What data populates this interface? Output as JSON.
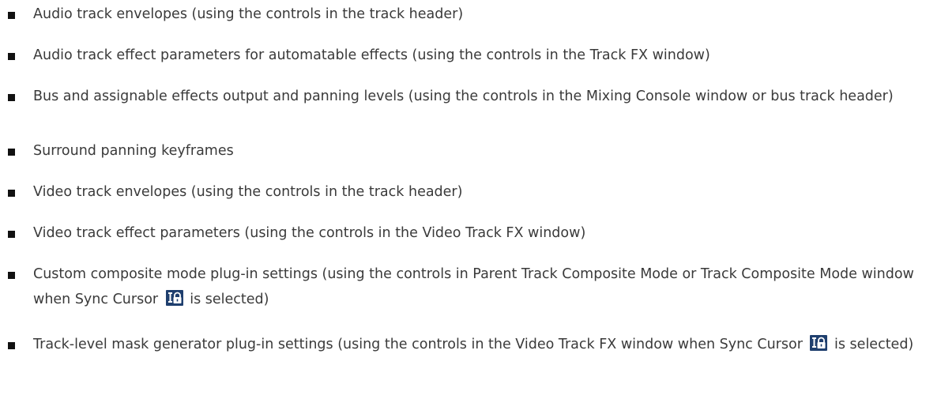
{
  "items": [
    {
      "text": "Audio track envelopes (using the controls in the track header)"
    },
    {
      "text": "Audio track effect parameters for automatable effects (using the controls in the Track FX window)"
    },
    {
      "text": "Bus and assignable effects output and panning levels (using the controls in the Mixing Console window or bus track header)"
    },
    {
      "text": "Surround panning keyframes"
    },
    {
      "text": "Video track envelopes (using the controls in the track header)"
    },
    {
      "text": "Video track effect parameters (using the controls in the Video Track FX window)"
    },
    {
      "text_before": "Custom composite mode plug-in settings (using the controls in Parent Track Composite Mode or Track Composite Mode window when Sync Cursor",
      "icon": "sync-cursor-icon",
      "text_after": "is selected)"
    },
    {
      "text_before": "Track-level mask generator plug-in settings (using the controls in the Video Track FX window when Sync Cursor",
      "icon": "sync-cursor-icon",
      "text_after": "is selected)"
    }
  ],
  "colors": {
    "text": "#3a3a3a",
    "bullet": "#111111",
    "icon_bg": "#1f3f6e",
    "icon_fg": "#ffffff"
  }
}
